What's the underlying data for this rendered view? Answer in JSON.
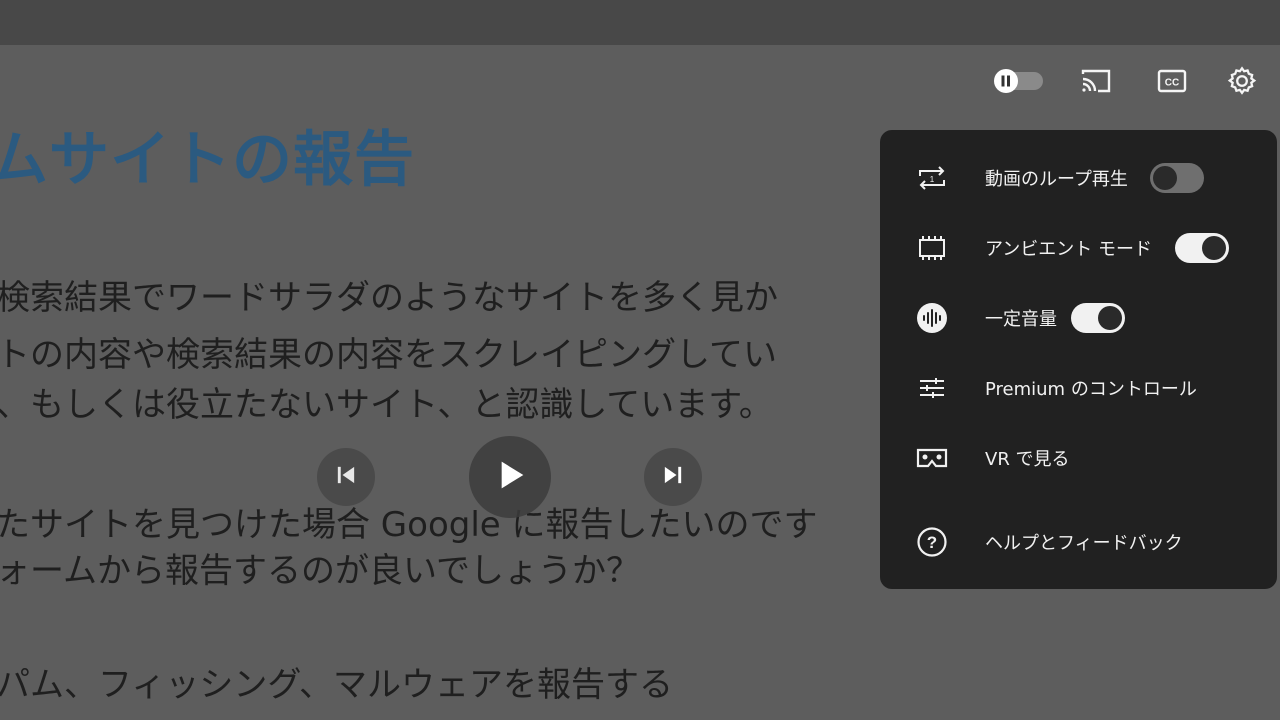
{
  "article": {
    "title": "ムサイトの報告",
    "lines": [
      "検索結果でワードサラダのようなサイトを多く見か",
      "トの内容や検索結果の内容をスクレイピングしてい",
      "、もしくは役立たないサイト、と認識しています。",
      "たサイトを見つけた場合 Google に報告したいのです",
      "ォームから報告するのが良いでしょうか？",
      "パム、フィッシング、マルウェアを報告する"
    ]
  },
  "player_controls": {
    "autoplay_state": "on",
    "icons": [
      "pause-toggle-icon",
      "cast-icon",
      "subtitles-icon",
      "settings-gear-icon"
    ],
    "center": [
      "previous-icon",
      "play-icon",
      "next-icon"
    ]
  },
  "settings_menu": {
    "items": [
      {
        "label": "動画のループ再生",
        "icon": "loop-one-icon",
        "toggle": "off"
      },
      {
        "label": "アンビエント モード",
        "icon": "ambient-tv-icon",
        "toggle": "on"
      },
      {
        "label": "一定音量",
        "icon": "stable-volume-icon",
        "toggle": "on"
      },
      {
        "label": "Premium のコントロール",
        "icon": "sliders-icon"
      },
      {
        "label": "VR で見る",
        "icon": "vr-headset-icon"
      },
      {
        "label": "ヘルプとフィードバック",
        "icon": "help-circle-icon"
      }
    ]
  },
  "colors": {
    "menu_bg": "#212121",
    "toggle_on": "#f1f1f1",
    "toggle_off": "#6f6f6f",
    "title_blue": "#2b5a80"
  }
}
